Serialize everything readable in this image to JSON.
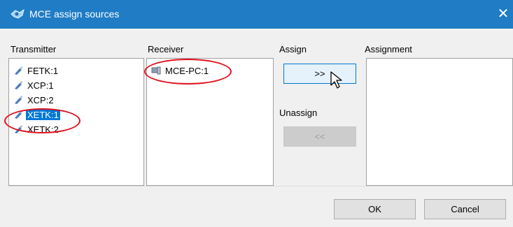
{
  "window": {
    "title": "MCE assign sources",
    "close_glyph": "✕"
  },
  "columns": {
    "transmitter": "Transmitter",
    "receiver": "Receiver",
    "assign": "Assign",
    "assignment": "Assignment",
    "unassign": "Unassign"
  },
  "transmitters": [
    {
      "label": "FETK:1",
      "selected": false
    },
    {
      "label": "XCP:1",
      "selected": false
    },
    {
      "label": "XCP:2",
      "selected": false
    },
    {
      "label": "XETK:1",
      "selected": true
    },
    {
      "label": "XETK:2",
      "selected": false
    }
  ],
  "receivers": [
    {
      "label": "MCE-PC:1",
      "selected": false
    }
  ],
  "buttons": {
    "assign": ">>",
    "unassign": "<<",
    "ok": "OK",
    "cancel": "Cancel"
  },
  "colors": {
    "titlebar": "#1f7cc5",
    "selection": "#0078d7",
    "highlight_ring": "#e0101d"
  },
  "icons": {
    "app": "network-icon",
    "transmitter": "probe-icon",
    "receiver": "computer-icon",
    "cursor": "mouse-pointer-icon"
  }
}
